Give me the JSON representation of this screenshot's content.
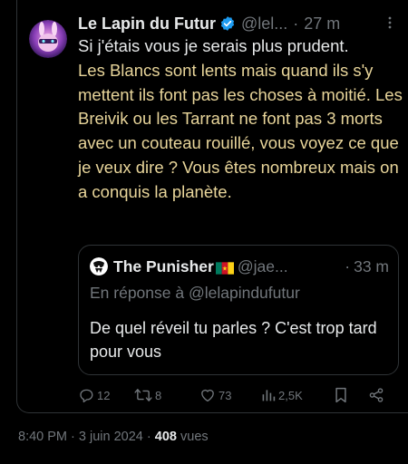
{
  "tweet": {
    "author": {
      "display_name": "Le Lapin du Futur",
      "handle": "@lel...",
      "verified_icon": "verified-badge-icon"
    },
    "separator": "·",
    "relative_time": "27 m",
    "more_icon": "more-horizontal-icon",
    "text_plain": "Si j'étais vous je serais plus prudent.",
    "text_highlighted": "Les Blancs sont lents mais quand ils s'y mettent ils font pas les choses à moitié. Les Breivik ou les Tarrant ne font pas 3 morts avec un couteau rouillé, vous voyez ce que je veux dire ? Vous êtes nombreux mais on a conquis la planète.",
    "highlight_color": "#e8d59a"
  },
  "quote": {
    "author": {
      "display_name": "The Punisher",
      "flag_icon": "cameroon-flag-icon",
      "handle": "@jae..."
    },
    "separator": "·",
    "relative_time": "33 m",
    "reply_to": "En réponse à @lelapindufutur",
    "text": "De quel réveil tu parles ? C'est trop tard pour vous"
  },
  "actions": {
    "reply": {
      "icon": "reply-icon",
      "count": "12"
    },
    "repost": {
      "icon": "repost-icon",
      "count": "8"
    },
    "like": {
      "icon": "heart-icon",
      "count": "73"
    },
    "views": {
      "icon": "views-chart-icon",
      "count": "2,5K"
    },
    "bookmark": {
      "icon": "bookmark-icon"
    },
    "share": {
      "icon": "share-icon"
    }
  },
  "footer": {
    "time": "8:40 PM",
    "separator1": "·",
    "date": "3 juin 2024",
    "separator2": "·",
    "views_count": "408",
    "views_label": "vues"
  },
  "colors": {
    "background": "#000000",
    "text": "#e7e9ea",
    "muted": "#71767b",
    "border": "#2f3336",
    "verified": "#1d9bf0"
  }
}
